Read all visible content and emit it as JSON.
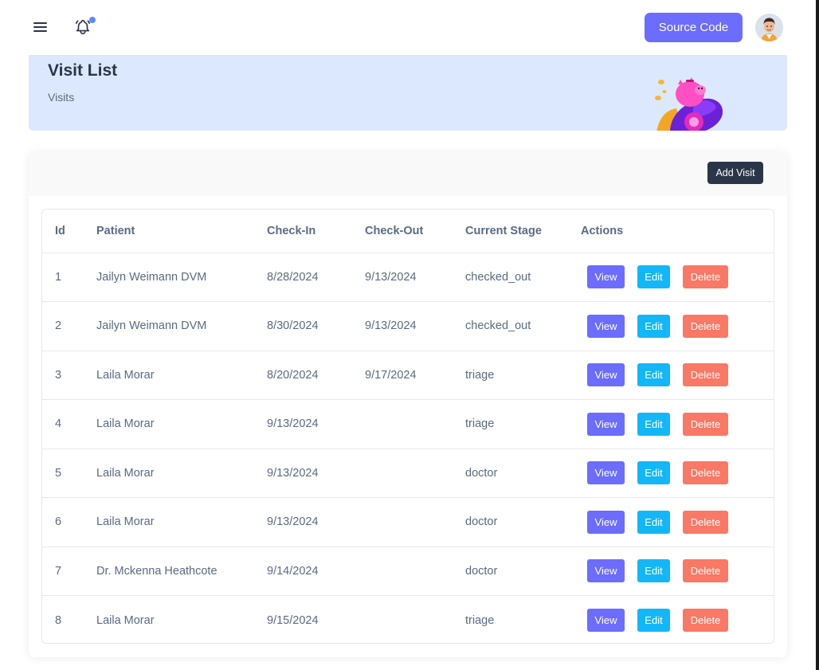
{
  "header": {
    "menu_icon": "hamburger-icon",
    "bell_icon": "bell-icon",
    "source_code_label": "Source Code",
    "accent_color": "#6c6cff"
  },
  "banner": {
    "title": "Visit List",
    "subtitle": "Visits",
    "background": "#dce8fd"
  },
  "card": {
    "add_label": "Add Visit"
  },
  "table": {
    "columns": [
      "Id",
      "Patient",
      "Check-In",
      "Check-Out",
      "Current Stage",
      "Actions"
    ],
    "actions": {
      "view": "View",
      "edit": "Edit",
      "delete": "Delete"
    },
    "rows": [
      [
        "1",
        "Jailyn Weimann DVM",
        "8/28/2024",
        "9/13/2024",
        "checked_out"
      ],
      [
        "2",
        "Jailyn Weimann DVM",
        "8/30/2024",
        "9/13/2024",
        "checked_out"
      ],
      [
        "3",
        "Laila Morar",
        "8/20/2024",
        "9/17/2024",
        "triage"
      ],
      [
        "4",
        "Laila Morar",
        "9/13/2024",
        "",
        "triage"
      ],
      [
        "5",
        "Laila Morar",
        "9/13/2024",
        "",
        "doctor"
      ],
      [
        "6",
        "Laila Morar",
        "9/13/2024",
        "",
        "doctor"
      ],
      [
        "7",
        "Dr. Mckenna Heathcote",
        "9/14/2024",
        "",
        "doctor"
      ],
      [
        "8",
        "Laila Morar",
        "9/15/2024",
        "",
        "triage"
      ]
    ]
  },
  "colors": {
    "view": "#6c6cff",
    "edit": "#13b7f7",
    "delete": "#fa7866",
    "dark": "#2a3547"
  }
}
